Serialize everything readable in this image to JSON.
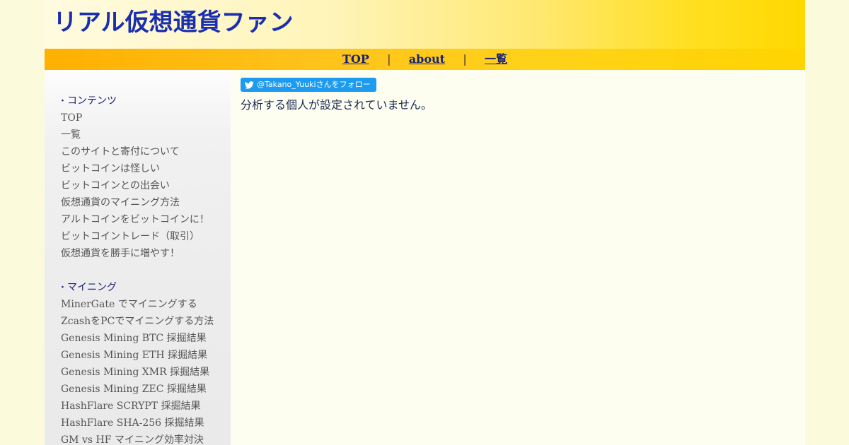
{
  "site": {
    "title": "リアル仮想通貨ファン"
  },
  "nav": {
    "items": [
      "TOP",
      "about",
      "一覧"
    ],
    "separator": "|"
  },
  "sidebar": {
    "sections": [
      {
        "heading": "コンテンツ",
        "items": [
          "TOP",
          "一覧",
          "このサイトと寄付について",
          "ビットコインは怪しい",
          "ビットコインとの出会い",
          "仮想通貨のマイニング方法",
          "アルトコインをビットコインに！",
          "ビットコイントレード（取引）",
          "仮想通貨を勝手に増やす！"
        ]
      },
      {
        "heading": "マイニング",
        "items": [
          "MinerGate でマイニングする",
          "ZcashをPCでマイニングする方法",
          "Genesis Mining BTC 採掘結果",
          "Genesis Mining ETH 採掘結果",
          "Genesis Mining XMR 採掘結果",
          "Genesis Mining ZEC 採掘結果",
          "HashFlare SCRYPT 採掘結果",
          "HashFlare SHA-256 採掘結果",
          "GM vs HF マイニング効率対決"
        ]
      }
    ]
  },
  "main": {
    "follow_button": "@Takano_Yuukiさんをフォロー",
    "message": "分析する個人が設定されていません。"
  },
  "colors": {
    "title": "#1a2fb0",
    "nav_link": "#16237a",
    "twitter": "#1d9bf0"
  },
  "icons": {
    "follow": "twitter-bird-icon"
  }
}
